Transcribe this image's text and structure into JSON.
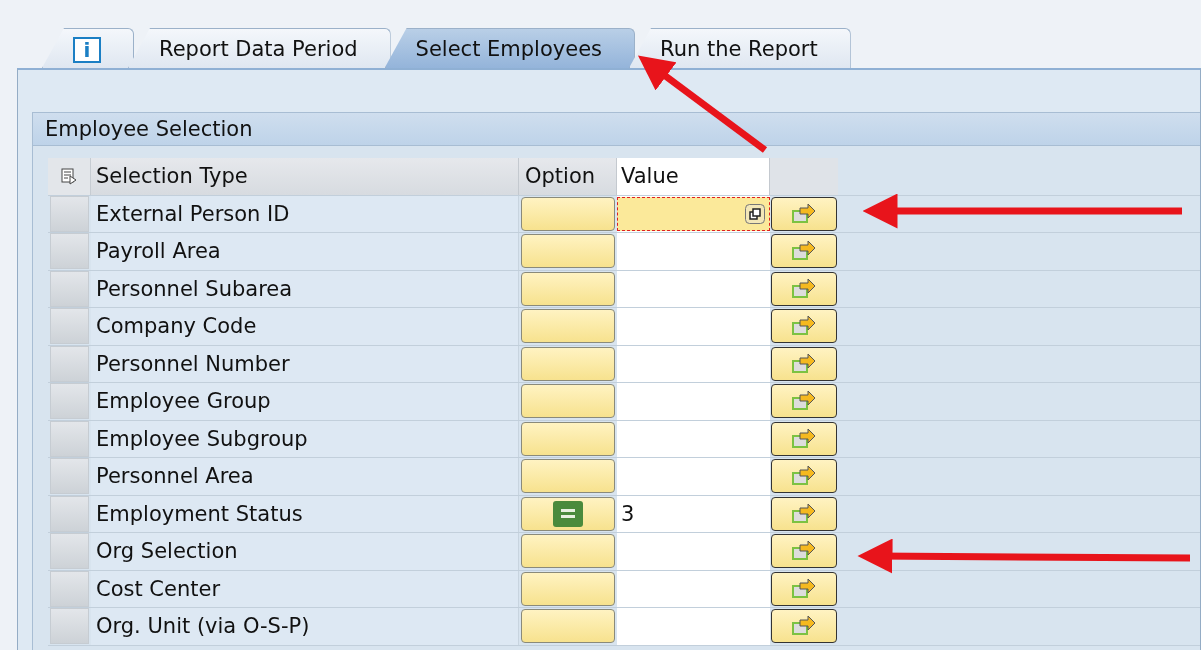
{
  "tabs": [
    {
      "kind": "info",
      "label": "i",
      "selected": false
    },
    {
      "kind": "text",
      "label": "Report Data Period",
      "selected": false
    },
    {
      "kind": "text",
      "label": "Select Employees",
      "selected": true
    },
    {
      "kind": "text",
      "label": "Run the Report",
      "selected": false
    }
  ],
  "group": {
    "title": "Employee Selection"
  },
  "table": {
    "columns": [
      "Selection Type",
      "Option",
      "Value"
    ],
    "rows": [
      {
        "label": "External Person ID",
        "kind": "plain",
        "value": "",
        "focused": true
      },
      {
        "label": "Payroll Area",
        "kind": "plain",
        "value": "",
        "focused": false
      },
      {
        "label": "Personnel Subarea",
        "kind": "plain",
        "value": "",
        "focused": false
      },
      {
        "label": "Company Code",
        "kind": "plain",
        "value": "",
        "focused": false
      },
      {
        "label": "Personnel Number",
        "kind": "plain",
        "value": "",
        "focused": false
      },
      {
        "label": "Employee Group",
        "kind": "plain",
        "value": "",
        "focused": false
      },
      {
        "label": "Employee Subgroup",
        "kind": "plain",
        "value": "",
        "focused": false
      },
      {
        "label": "Personnel Area",
        "kind": "plain",
        "value": "",
        "focused": false
      },
      {
        "label": "Employment Status",
        "kind": "equals",
        "value": "3",
        "focused": false
      },
      {
        "label": "Org Selection",
        "kind": "plain",
        "value": "",
        "focused": false
      },
      {
        "label": "Cost Center",
        "kind": "plain",
        "value": "",
        "focused": false
      },
      {
        "label": "Org. Unit (via O-S-P)",
        "kind": "plain",
        "value": "",
        "focused": false
      }
    ]
  }
}
